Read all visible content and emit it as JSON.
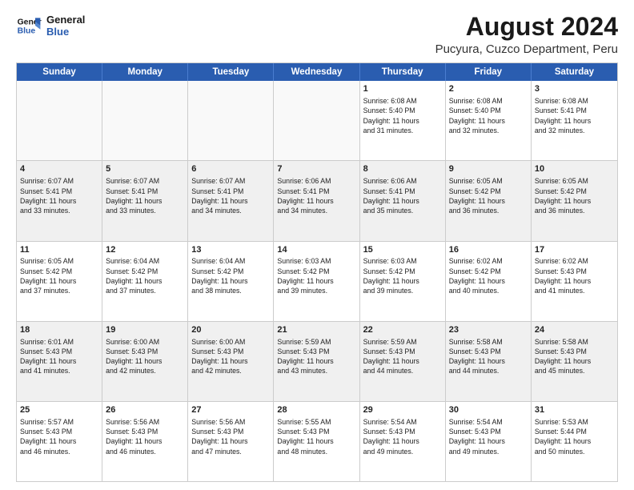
{
  "logo": {
    "line1": "General",
    "line2": "Blue"
  },
  "title": "August 2024",
  "subtitle": "Pucyura, Cuzco Department, Peru",
  "header_days": [
    "Sunday",
    "Monday",
    "Tuesday",
    "Wednesday",
    "Thursday",
    "Friday",
    "Saturday"
  ],
  "weeks": [
    [
      {
        "day": "",
        "info": ""
      },
      {
        "day": "",
        "info": ""
      },
      {
        "day": "",
        "info": ""
      },
      {
        "day": "",
        "info": ""
      },
      {
        "day": "1",
        "info": "Sunrise: 6:08 AM\nSunset: 5:40 PM\nDaylight: 11 hours\nand 31 minutes."
      },
      {
        "day": "2",
        "info": "Sunrise: 6:08 AM\nSunset: 5:40 PM\nDaylight: 11 hours\nand 32 minutes."
      },
      {
        "day": "3",
        "info": "Sunrise: 6:08 AM\nSunset: 5:41 PM\nDaylight: 11 hours\nand 32 minutes."
      }
    ],
    [
      {
        "day": "4",
        "info": "Sunrise: 6:07 AM\nSunset: 5:41 PM\nDaylight: 11 hours\nand 33 minutes."
      },
      {
        "day": "5",
        "info": "Sunrise: 6:07 AM\nSunset: 5:41 PM\nDaylight: 11 hours\nand 33 minutes."
      },
      {
        "day": "6",
        "info": "Sunrise: 6:07 AM\nSunset: 5:41 PM\nDaylight: 11 hours\nand 34 minutes."
      },
      {
        "day": "7",
        "info": "Sunrise: 6:06 AM\nSunset: 5:41 PM\nDaylight: 11 hours\nand 34 minutes."
      },
      {
        "day": "8",
        "info": "Sunrise: 6:06 AM\nSunset: 5:41 PM\nDaylight: 11 hours\nand 35 minutes."
      },
      {
        "day": "9",
        "info": "Sunrise: 6:05 AM\nSunset: 5:42 PM\nDaylight: 11 hours\nand 36 minutes."
      },
      {
        "day": "10",
        "info": "Sunrise: 6:05 AM\nSunset: 5:42 PM\nDaylight: 11 hours\nand 36 minutes."
      }
    ],
    [
      {
        "day": "11",
        "info": "Sunrise: 6:05 AM\nSunset: 5:42 PM\nDaylight: 11 hours\nand 37 minutes."
      },
      {
        "day": "12",
        "info": "Sunrise: 6:04 AM\nSunset: 5:42 PM\nDaylight: 11 hours\nand 37 minutes."
      },
      {
        "day": "13",
        "info": "Sunrise: 6:04 AM\nSunset: 5:42 PM\nDaylight: 11 hours\nand 38 minutes."
      },
      {
        "day": "14",
        "info": "Sunrise: 6:03 AM\nSunset: 5:42 PM\nDaylight: 11 hours\nand 39 minutes."
      },
      {
        "day": "15",
        "info": "Sunrise: 6:03 AM\nSunset: 5:42 PM\nDaylight: 11 hours\nand 39 minutes."
      },
      {
        "day": "16",
        "info": "Sunrise: 6:02 AM\nSunset: 5:42 PM\nDaylight: 11 hours\nand 40 minutes."
      },
      {
        "day": "17",
        "info": "Sunrise: 6:02 AM\nSunset: 5:43 PM\nDaylight: 11 hours\nand 41 minutes."
      }
    ],
    [
      {
        "day": "18",
        "info": "Sunrise: 6:01 AM\nSunset: 5:43 PM\nDaylight: 11 hours\nand 41 minutes."
      },
      {
        "day": "19",
        "info": "Sunrise: 6:00 AM\nSunset: 5:43 PM\nDaylight: 11 hours\nand 42 minutes."
      },
      {
        "day": "20",
        "info": "Sunrise: 6:00 AM\nSunset: 5:43 PM\nDaylight: 11 hours\nand 42 minutes."
      },
      {
        "day": "21",
        "info": "Sunrise: 5:59 AM\nSunset: 5:43 PM\nDaylight: 11 hours\nand 43 minutes."
      },
      {
        "day": "22",
        "info": "Sunrise: 5:59 AM\nSunset: 5:43 PM\nDaylight: 11 hours\nand 44 minutes."
      },
      {
        "day": "23",
        "info": "Sunrise: 5:58 AM\nSunset: 5:43 PM\nDaylight: 11 hours\nand 44 minutes."
      },
      {
        "day": "24",
        "info": "Sunrise: 5:58 AM\nSunset: 5:43 PM\nDaylight: 11 hours\nand 45 minutes."
      }
    ],
    [
      {
        "day": "25",
        "info": "Sunrise: 5:57 AM\nSunset: 5:43 PM\nDaylight: 11 hours\nand 46 minutes."
      },
      {
        "day": "26",
        "info": "Sunrise: 5:56 AM\nSunset: 5:43 PM\nDaylight: 11 hours\nand 46 minutes."
      },
      {
        "day": "27",
        "info": "Sunrise: 5:56 AM\nSunset: 5:43 PM\nDaylight: 11 hours\nand 47 minutes."
      },
      {
        "day": "28",
        "info": "Sunrise: 5:55 AM\nSunset: 5:43 PM\nDaylight: 11 hours\nand 48 minutes."
      },
      {
        "day": "29",
        "info": "Sunrise: 5:54 AM\nSunset: 5:43 PM\nDaylight: 11 hours\nand 49 minutes."
      },
      {
        "day": "30",
        "info": "Sunrise: 5:54 AM\nSunset: 5:43 PM\nDaylight: 11 hours\nand 49 minutes."
      },
      {
        "day": "31",
        "info": "Sunrise: 5:53 AM\nSunset: 5:44 PM\nDaylight: 11 hours\nand 50 minutes."
      }
    ]
  ]
}
